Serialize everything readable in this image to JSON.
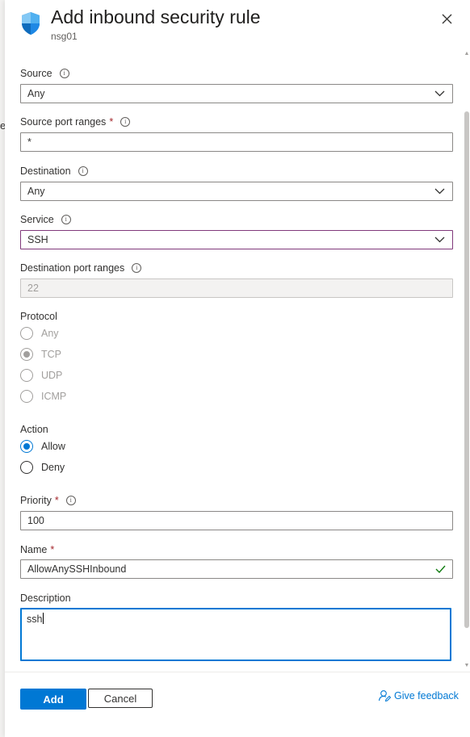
{
  "background": {
    "peek_char": "e"
  },
  "header": {
    "title": "Add inbound security rule",
    "subtitle": "nsg01",
    "icon": "shield-icon",
    "close_icon": "close-icon"
  },
  "form": {
    "source": {
      "label": "Source",
      "value": "Any"
    },
    "source_port_ranges": {
      "label": "Source port ranges",
      "required_mark": "*",
      "value": "*"
    },
    "destination": {
      "label": "Destination",
      "value": "Any"
    },
    "service": {
      "label": "Service",
      "value": "SSH"
    },
    "destination_port_ranges": {
      "label": "Destination port ranges",
      "value": "22"
    },
    "protocol": {
      "label": "Protocol",
      "options": [
        "Any",
        "TCP",
        "UDP",
        "ICMP"
      ],
      "selected": "TCP",
      "disabled": true
    },
    "action": {
      "label": "Action",
      "options": [
        "Allow",
        "Deny"
      ],
      "selected": "Allow"
    },
    "priority": {
      "label": "Priority",
      "required_mark": "*",
      "value": "100"
    },
    "name": {
      "label": "Name",
      "required_mark": "*",
      "value": "AllowAnySSHInbound"
    },
    "description": {
      "label": "Description",
      "value": "ssh"
    }
  },
  "footer": {
    "add_label": "Add",
    "cancel_label": "Cancel",
    "feedback_label": "Give feedback"
  },
  "colors": {
    "accent": "#0078d4",
    "focus_border": "#80397b",
    "required": "#a4262c",
    "valid": "#107c10"
  }
}
